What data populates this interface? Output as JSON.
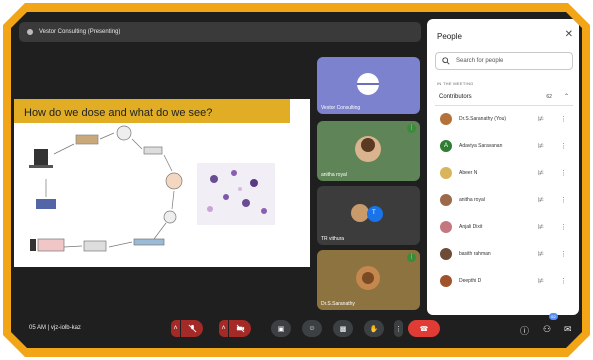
{
  "meeting": {
    "presenting_label": "Vestor Consulting (Presenting)",
    "time": "05 AM",
    "separator": "|",
    "code": "vjz-iolb-kaz"
  },
  "slide": {
    "title": "How do we dose and what do we see?"
  },
  "tiles": [
    {
      "name": "Vestor Consulting",
      "initial": ""
    },
    {
      "name": "anitha royal",
      "initial": ""
    },
    {
      "name": "TR vithura",
      "initial": "T"
    },
    {
      "name": "Dr.S.Saranathy",
      "initial": ""
    }
  ],
  "people_panel": {
    "title": "People",
    "search_placeholder": "Search for people",
    "in_meeting_label": "IN THE MEETING",
    "contributors_label": "Contributors",
    "contributors_count": "62",
    "participants": [
      {
        "name": "Dr.S.Saranathy (You)",
        "initial": "",
        "color": "#b5713a"
      },
      {
        "name": "Adaviya Saravanan",
        "initial": "A",
        "color": "#2e7d32"
      },
      {
        "name": "Abeer N",
        "initial": "",
        "color": "#d8b45a"
      },
      {
        "name": "anitha royal",
        "initial": "",
        "color": "#9c6a4a"
      },
      {
        "name": "Anjali Dixit",
        "initial": "",
        "color": "#c4777f"
      },
      {
        "name": "basith rahman",
        "initial": "",
        "color": "#6d4b35"
      },
      {
        "name": "Deepthi D",
        "initial": "",
        "color": "#a0522d"
      }
    ]
  },
  "colors": {
    "accent_frame": "#f2a516",
    "end_call": "#e03b34",
    "muted_button": "#a32a26"
  },
  "controls": {
    "participants_badge": "62"
  },
  "icons": [
    "mic-off-icon",
    "camera-off-icon",
    "captions-icon",
    "emoji-icon",
    "present-icon",
    "raise-hand-icon",
    "more-icon",
    "end-call-icon",
    "info-icon",
    "people-icon",
    "chat-icon",
    "search-icon",
    "close-icon",
    "chevron-up-icon"
  ]
}
